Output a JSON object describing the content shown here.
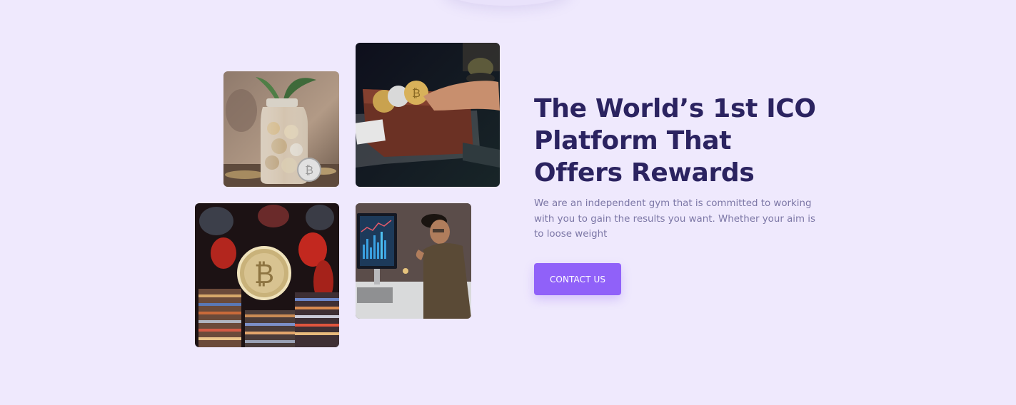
{
  "section": {
    "headline": "The World’s 1st ICO Platform That Offers Rewards",
    "description": "We are an independent gym that is committed to working with you to gain the results you want. Whether your aim is to loose weight",
    "cta_label": "CONTACT US"
  },
  "images": [
    {
      "name": "coin-jar-photo"
    },
    {
      "name": "crypto-wallet-photo"
    },
    {
      "name": "bitcoin-stacks-photo"
    },
    {
      "name": "trader-photo"
    }
  ],
  "colors": {
    "background": "#efe9fd",
    "heading": "#2b2360",
    "body_text": "#7c77a6",
    "accent": "#9061f9"
  }
}
